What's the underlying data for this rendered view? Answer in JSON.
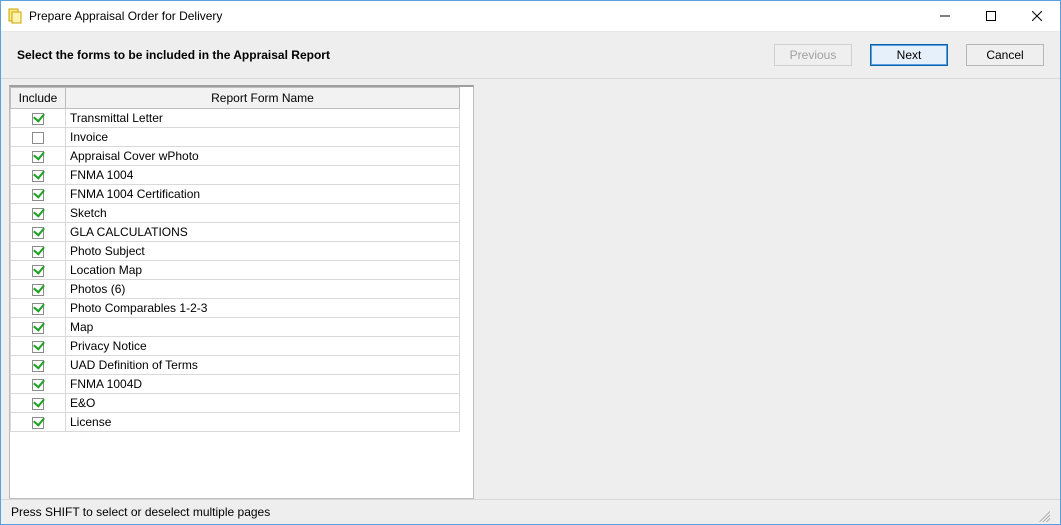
{
  "window": {
    "title": "Prepare Appraisal Order for Delivery"
  },
  "header": {
    "instruction": "Select the forms to be included in the Appraisal Report",
    "buttons": {
      "previous": "Previous",
      "next": "Next",
      "cancel": "Cancel"
    }
  },
  "grid": {
    "columns": {
      "include": "Include",
      "name": "Report Form Name"
    },
    "rows": [
      {
        "checked": true,
        "name": "Transmittal Letter"
      },
      {
        "checked": false,
        "name": "Invoice"
      },
      {
        "checked": true,
        "name": "Appraisal Cover wPhoto"
      },
      {
        "checked": true,
        "name": "FNMA 1004"
      },
      {
        "checked": true,
        "name": "FNMA 1004 Certification"
      },
      {
        "checked": true,
        "name": "Sketch"
      },
      {
        "checked": true,
        "name": "GLA CALCULATIONS"
      },
      {
        "checked": true,
        "name": "Photo Subject"
      },
      {
        "checked": true,
        "name": "Location Map"
      },
      {
        "checked": true,
        "name": "Photos (6)"
      },
      {
        "checked": true,
        "name": "Photo Comparables 1-2-3"
      },
      {
        "checked": true,
        "name": "Map"
      },
      {
        "checked": true,
        "name": "Privacy Notice"
      },
      {
        "checked": true,
        "name": "UAD Definition of Terms"
      },
      {
        "checked": true,
        "name": "FNMA 1004D"
      },
      {
        "checked": true,
        "name": "E&O"
      },
      {
        "checked": true,
        "name": "License"
      }
    ]
  },
  "footer": {
    "hint": "Press SHIFT to select or deselect multiple pages"
  }
}
